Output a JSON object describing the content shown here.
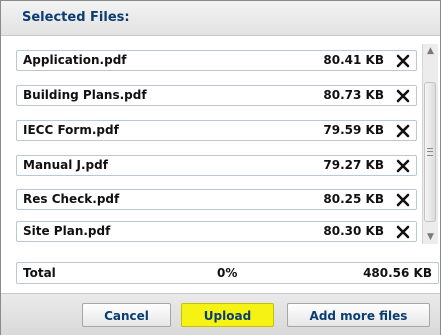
{
  "header": {
    "title": "Selected Files:"
  },
  "files": [
    {
      "name": "Application.pdf",
      "size": "80.41 KB",
      "remove_icon": "close-x-icon"
    },
    {
      "name": "Building Plans.pdf",
      "size": "80.73 KB",
      "remove_icon": "close-x-icon"
    },
    {
      "name": "IECC Form.pdf",
      "size": "79.59 KB",
      "remove_icon": "close-x-icon"
    },
    {
      "name": "Manual J.pdf",
      "size": "79.27 KB",
      "remove_icon": "close-x-icon"
    },
    {
      "name": "Res Check.pdf",
      "size": "80.25 KB",
      "remove_icon": "close-x-icon"
    },
    {
      "name": "Site Plan.pdf",
      "size": "80.30 KB",
      "remove_icon": "close-x-icon"
    }
  ],
  "total": {
    "label": "Total",
    "percent": "0%",
    "size": "480.56 KB"
  },
  "buttons": {
    "cancel_label": "Cancel",
    "upload_label": "Upload",
    "add_more_label": "Add more files"
  },
  "colors": {
    "title_text": "#0b3d73",
    "upload_highlight": "#f5f214",
    "row_border": "#b9c7d8"
  }
}
